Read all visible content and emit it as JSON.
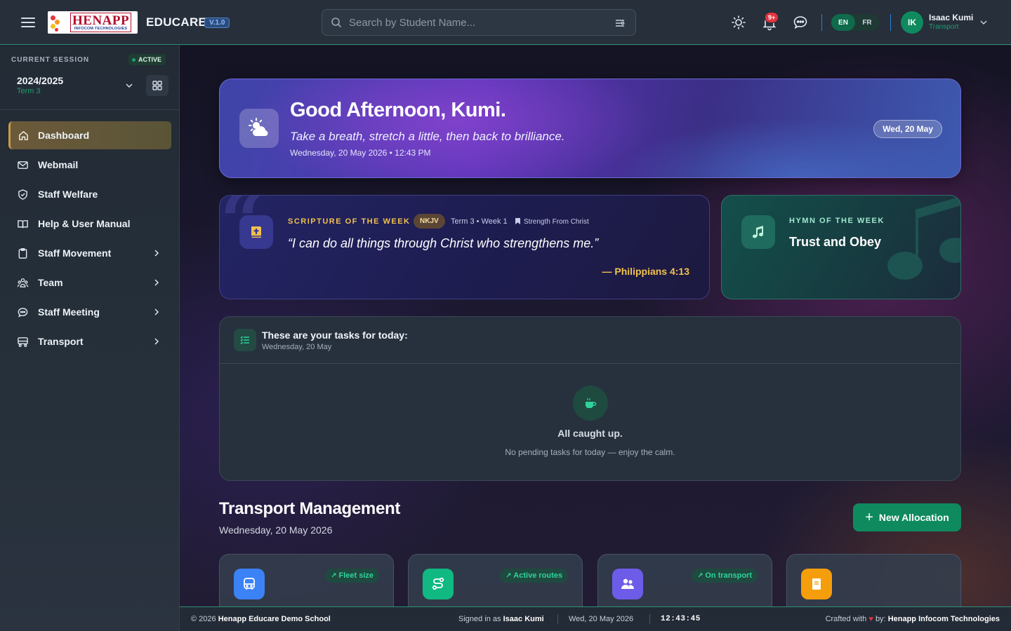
{
  "topbar": {
    "logo_big": "HENAPP",
    "logo_small": "INFOCOM TECHNOLOGIES",
    "brand": "EDUCARE",
    "version": "V.1.0",
    "search_placeholder": "Search by Student Name...",
    "notification_count": "9+",
    "languages": [
      {
        "code": "EN",
        "active": true
      },
      {
        "code": "FR",
        "active": false
      }
    ],
    "user": {
      "initials": "IK",
      "name": "Isaac Kumi",
      "role": "Transport"
    },
    "icons": [
      "menu-icon",
      "search-icon",
      "filter-icon",
      "sun-icon",
      "bell-icon",
      "chat-icon",
      "chevron-down-icon"
    ]
  },
  "sidebar": {
    "session_label": "CURRENT SESSION",
    "session_status": "ACTIVE",
    "session_year": "2024/2025",
    "session_term": "Term 3",
    "items": [
      {
        "label": "Dashboard",
        "icon": "home-icon",
        "active": true,
        "has_submenu": false
      },
      {
        "label": "Webmail",
        "icon": "mail-icon",
        "active": false,
        "has_submenu": false
      },
      {
        "label": "Staff Welfare",
        "icon": "shield-icon",
        "active": false,
        "has_submenu": false
      },
      {
        "label": "Help & User Manual",
        "icon": "book-icon",
        "active": false,
        "has_submenu": false
      },
      {
        "label": "Staff Movement",
        "icon": "clipboard-icon",
        "active": false,
        "has_submenu": true
      },
      {
        "label": "Team",
        "icon": "team-icon",
        "active": false,
        "has_submenu": true
      },
      {
        "label": "Staff Meeting",
        "icon": "chat-icon",
        "active": false,
        "has_submenu": true
      },
      {
        "label": "Transport",
        "icon": "route-icon",
        "active": false,
        "has_submenu": true
      }
    ]
  },
  "hero": {
    "greeting": "Good Afternoon, Kumi.",
    "subtitle": "Take a breath, stretch a little, then back to brilliance.",
    "datetime": "Wednesday, 20 May 2026 • 12:43 PM",
    "date_pill": "Wed, 20 May"
  },
  "scripture": {
    "label": "SCRIPTURE OF THE WEEK",
    "version": "NKJV",
    "term_week": "Term 3 • Week 1",
    "theme": "Strength From Christ",
    "text": "“I can do all things through Christ who strengthens me.”",
    "reference": "— Philippians 4:13"
  },
  "hymn": {
    "label": "HYMN OF THE WEEK",
    "title": "Trust and Obey"
  },
  "tasks": {
    "title": "These are your tasks for today:",
    "date": "Wednesday, 20 May",
    "empty_title": "All caught up.",
    "empty_text": "No pending tasks for today — enjoy the calm."
  },
  "transport": {
    "title": "Transport Management",
    "date": "Wednesday, 20 May 2026",
    "new_button": "New Allocation",
    "stats": [
      {
        "tag": "Fleet size",
        "icon": "bus-icon",
        "color": "#3b82f6"
      },
      {
        "tag": "Active routes",
        "icon": "route-icon",
        "color": "#10b981"
      },
      {
        "tag": "On transport",
        "icon": "users-icon",
        "color": "#6d5ce8"
      },
      {
        "tag": "",
        "icon": "document-icon",
        "color": "#f59e0b"
      }
    ]
  },
  "footer": {
    "copyright_prefix": "© 2026",
    "school": "Henapp Educare Demo School",
    "signed_in_prefix": "Signed in as",
    "signed_in_user": "Isaac Kumi",
    "date": "Wed, 20 May 2026",
    "time": "12:43:45",
    "crafted_prefix": "Crafted with",
    "crafted_by": "by:",
    "company": "Henapp Infocom Technologies"
  },
  "colors": {
    "accent_green": "#0f8a5f",
    "gold": "#f2c14e",
    "notification_red": "#e3343f"
  }
}
